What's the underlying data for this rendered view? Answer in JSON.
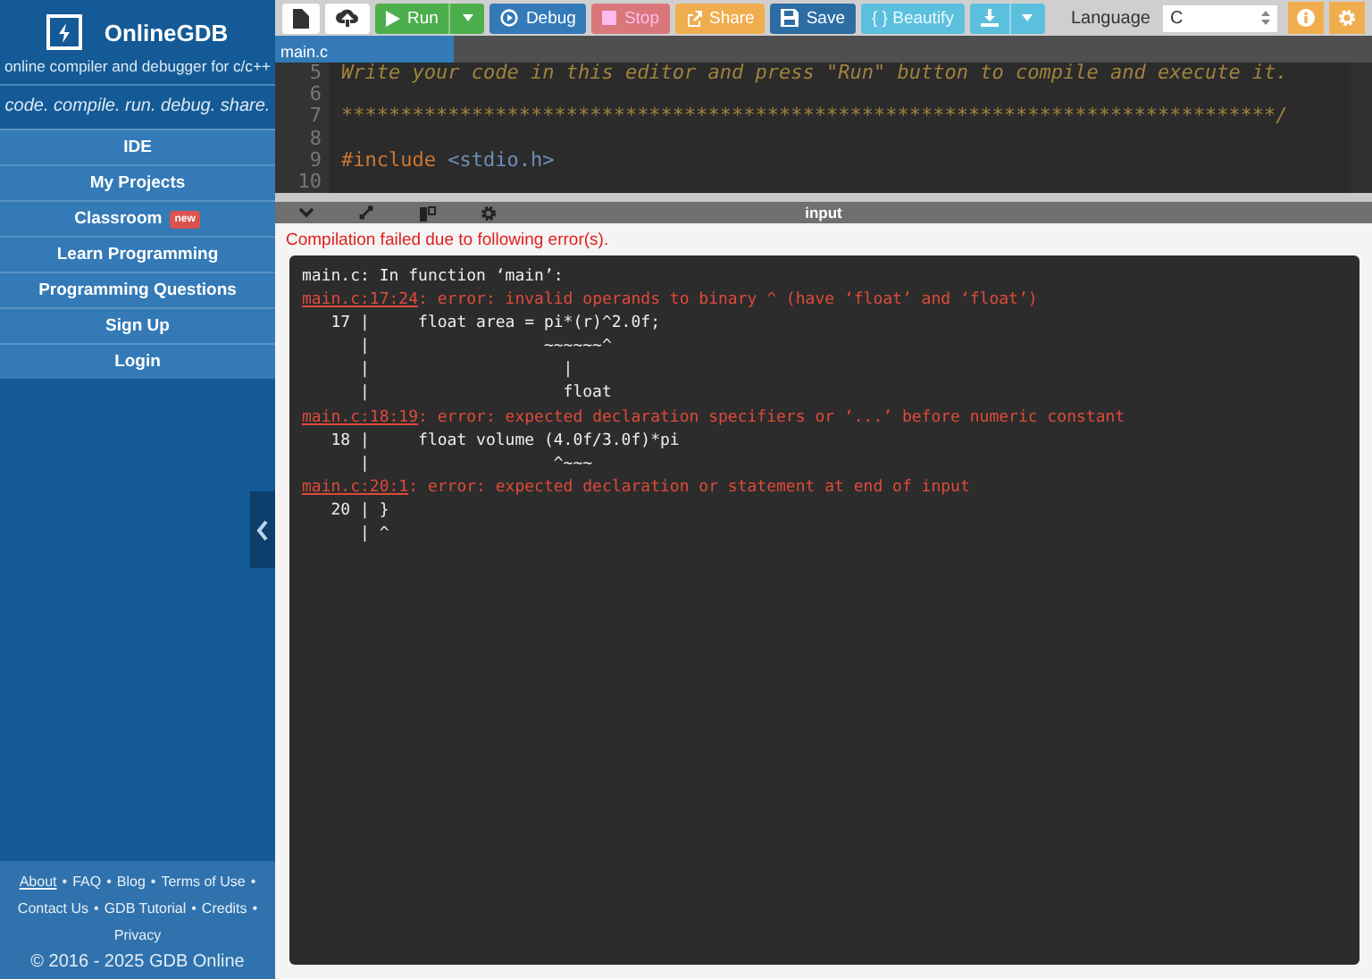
{
  "sidebar": {
    "brand": "OnlineGDB",
    "subtitle": "online compiler and debugger for c/c++",
    "tagline": "code. compile. run. debug. share.",
    "nav": [
      {
        "label": "IDE"
      },
      {
        "label": "My Projects"
      },
      {
        "label": "Classroom",
        "badge": "new"
      },
      {
        "label": "Learn Programming"
      },
      {
        "label": "Programming Questions"
      },
      {
        "label": "Sign Up"
      },
      {
        "label": "Login"
      }
    ],
    "footer": {
      "separator": "•",
      "links": [
        {
          "label": "About",
          "underlined": true
        },
        {
          "label": "FAQ",
          "underlined": false
        },
        {
          "label": "Blog",
          "underlined": false
        },
        {
          "label": "Terms of Use",
          "underlined": false
        },
        {
          "label": "Contact Us",
          "underlined": false
        },
        {
          "label": "GDB Tutorial",
          "underlined": false
        },
        {
          "label": "Credits",
          "underlined": false
        },
        {
          "label": "Privacy",
          "underlined": false
        }
      ],
      "copyright": "© 2016 - 2025 GDB Online"
    }
  },
  "toolbar": {
    "buttons": [
      {
        "kind": "new-file"
      },
      {
        "kind": "upload"
      },
      {
        "kind": "run",
        "label": "Run"
      },
      {
        "kind": "debug",
        "label": "Debug"
      },
      {
        "kind": "stop",
        "label": "Stop"
      },
      {
        "kind": "share",
        "label": "Share"
      },
      {
        "kind": "save",
        "label": "Save"
      },
      {
        "kind": "beautify",
        "label": "{ } Beautify"
      },
      {
        "kind": "download"
      }
    ],
    "language_label": "Language",
    "language": "C"
  },
  "tabs": [
    {
      "label": "main.c",
      "selected": true
    }
  ],
  "editor": {
    "lines": [
      {
        "number": "5",
        "tokens": [
          {
            "kind": "comment",
            "text": "Write your code in this editor and press \"Run\" button to compile and execute it."
          }
        ]
      },
      {
        "number": "6"
      },
      {
        "number": "7",
        "tokens": [
          {
            "kind": "comment",
            "text": "*******************************************************************************/"
          }
        ]
      },
      {
        "number": "8"
      },
      {
        "number": "9",
        "tokens": [
          {
            "kind": "directive",
            "text": "#include"
          },
          {
            "kind": "header",
            "text": " <stdio.h>"
          }
        ]
      },
      {
        "number": "10"
      }
    ]
  },
  "output": {
    "panel_title": "input",
    "status": "Compilation failed due to following error(s).",
    "lines": [
      {
        "kind": "plain",
        "text": "main.c: In function ‘main’:"
      },
      {
        "kind": "error",
        "location": "main.c:17:24",
        "message": ": error: invalid operands to binary ^ (have ‘float’ and ‘float’)"
      },
      {
        "kind": "plain",
        "text": "   17 |     float area = pi*(r)^2.0f;"
      },
      {
        "kind": "plain",
        "text": "      |                  ~~~~~~^"
      },
      {
        "kind": "plain",
        "text": "      |                    |"
      },
      {
        "kind": "plain",
        "text": "      |                    float"
      },
      {
        "kind": "error",
        "location": "main.c:18:19",
        "message": ": error: expected declaration specifiers or ‘...’ before numeric constant"
      },
      {
        "kind": "plain",
        "text": "   18 |     float volume (4.0f/3.0f)*pi"
      },
      {
        "kind": "plain",
        "text": "      |                   ^~~~"
      },
      {
        "kind": "error",
        "location": "main.c:20:1",
        "message": ": error: expected declaration or statement at end of input"
      },
      {
        "kind": "plain",
        "text": "   20 | }"
      },
      {
        "kind": "plain",
        "text": "      | ^"
      }
    ]
  }
}
